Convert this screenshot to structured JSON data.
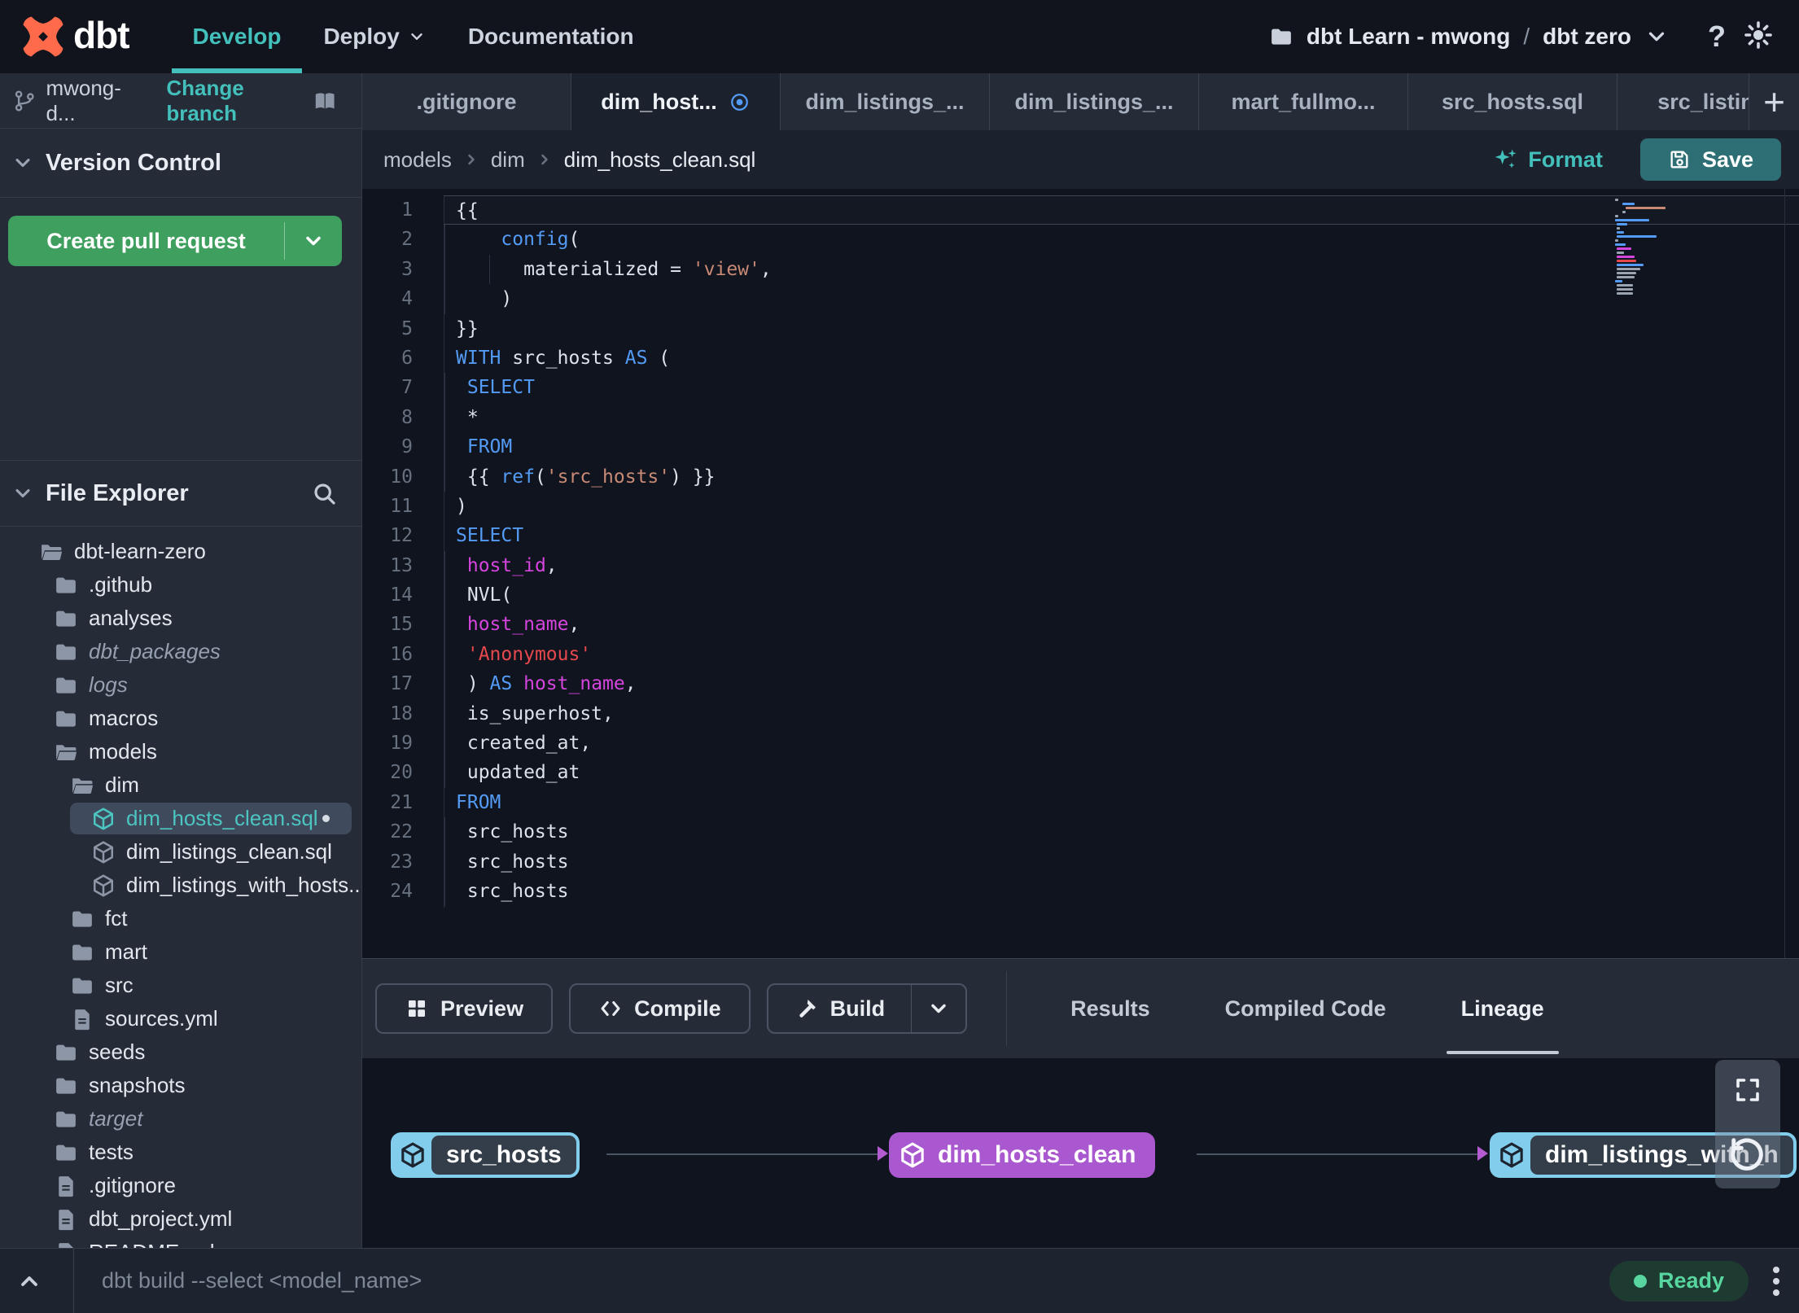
{
  "topnav": {
    "logo_text": "dbt",
    "items": [
      {
        "label": "Develop",
        "active": true,
        "caret": false
      },
      {
        "label": "Deploy",
        "active": false,
        "caret": true
      },
      {
        "label": "Documentation",
        "active": false,
        "caret": false
      }
    ],
    "account": "dbt Learn - mwong",
    "separator": "/",
    "project": "dbt zero"
  },
  "sidebar": {
    "branch_name": "mwong-d...",
    "change_branch_label": "Change branch",
    "version_control_label": "Version Control",
    "create_pr_label": "Create pull request",
    "file_explorer_label": "File Explorer",
    "tree": [
      {
        "label": "dbt-learn-zero",
        "icon": "folder-open",
        "level": 0
      },
      {
        "label": ".github",
        "icon": "folder",
        "level": 1
      },
      {
        "label": "analyses",
        "icon": "folder",
        "level": 1
      },
      {
        "label": "dbt_packages",
        "icon": "folder",
        "level": 1,
        "italic": true
      },
      {
        "label": "logs",
        "icon": "folder",
        "level": 1,
        "italic": true
      },
      {
        "label": "macros",
        "icon": "folder",
        "level": 1
      },
      {
        "label": "models",
        "icon": "folder-open",
        "level": 1
      },
      {
        "label": "dim",
        "icon": "folder-open",
        "level": 2
      },
      {
        "label": "dim_hosts_clean.sql",
        "icon": "model",
        "level": 3,
        "selected": true,
        "modified": true
      },
      {
        "label": "dim_listings_clean.sql",
        "icon": "model",
        "level": 3
      },
      {
        "label": "dim_listings_with_hosts...",
        "icon": "model",
        "level": 3
      },
      {
        "label": "fct",
        "icon": "folder",
        "level": 2
      },
      {
        "label": "mart",
        "icon": "folder",
        "level": 2
      },
      {
        "label": "src",
        "icon": "folder",
        "level": 2
      },
      {
        "label": "sources.yml",
        "icon": "file",
        "level": 2
      },
      {
        "label": "seeds",
        "icon": "folder",
        "level": 1
      },
      {
        "label": "snapshots",
        "icon": "folder",
        "level": 1
      },
      {
        "label": "target",
        "icon": "folder",
        "level": 1,
        "italic": true
      },
      {
        "label": "tests",
        "icon": "folder",
        "level": 1
      },
      {
        "label": ".gitignore",
        "icon": "file",
        "level": 1
      },
      {
        "label": "dbt_project.yml",
        "icon": "file",
        "level": 1
      },
      {
        "label": "README.md",
        "icon": "file",
        "level": 1
      }
    ]
  },
  "tabs": {
    "items": [
      {
        "label": ".gitignore"
      },
      {
        "label": "dim_host...",
        "active": true,
        "modified": true
      },
      {
        "label": "dim_listings_..."
      },
      {
        "label": "dim_listings_..."
      },
      {
        "label": "mart_fullmo..."
      },
      {
        "label": "src_hosts.sql"
      },
      {
        "label": "src_listings."
      }
    ],
    "add_label": "+"
  },
  "editor_header": {
    "breadcrumb": [
      "models",
      "dim",
      "dim_hosts_clean.sql"
    ],
    "format_label": "Format",
    "save_label": "Save"
  },
  "editor": {
    "lines": [
      {
        "n": 1,
        "current": true,
        "tokens": [
          [
            "w",
            "{{"
          ]
        ]
      },
      {
        "n": 2,
        "guides": [
          0
        ],
        "tokens": [
          [
            "w",
            "    "
          ],
          [
            "b",
            "config"
          ],
          [
            "w",
            "("
          ]
        ]
      },
      {
        "n": 3,
        "guides": [
          0,
          4
        ],
        "tokens": [
          [
            "w",
            "      materialized = "
          ],
          [
            "s",
            "'view'"
          ],
          [
            "w",
            ","
          ]
        ]
      },
      {
        "n": 4,
        "guides": [
          0
        ],
        "tokens": [
          [
            "w",
            "    )"
          ]
        ]
      },
      {
        "n": 5,
        "tokens": [
          [
            "w",
            "}}"
          ]
        ]
      },
      {
        "n": 6,
        "tokens": [
          [
            "b",
            "WITH"
          ],
          [
            "w",
            " src_hosts "
          ],
          [
            "b",
            "AS"
          ],
          [
            "w",
            " ("
          ]
        ]
      },
      {
        "n": 7,
        "guides": [
          0
        ],
        "tokens": [
          [
            "w",
            " "
          ],
          [
            "b",
            "SELECT"
          ]
        ]
      },
      {
        "n": 8,
        "guides": [
          0
        ],
        "tokens": [
          [
            "w",
            " *"
          ]
        ]
      },
      {
        "n": 9,
        "guides": [
          0
        ],
        "tokens": [
          [
            "w",
            " "
          ],
          [
            "b",
            "FROM"
          ]
        ]
      },
      {
        "n": 10,
        "guides": [
          0
        ],
        "tokens": [
          [
            "w",
            " {{ "
          ],
          [
            "b",
            "ref"
          ],
          [
            "w",
            "("
          ],
          [
            "s",
            "'src_hosts'"
          ],
          [
            "w",
            ") }}"
          ]
        ]
      },
      {
        "n": 11,
        "tokens": [
          [
            "w",
            ")"
          ]
        ]
      },
      {
        "n": 12,
        "tokens": [
          [
            "b",
            "SELECT"
          ]
        ]
      },
      {
        "n": 13,
        "guides": [
          0
        ],
        "tokens": [
          [
            "w",
            " "
          ],
          [
            "m",
            "host_id"
          ],
          [
            "w",
            ","
          ]
        ]
      },
      {
        "n": 14,
        "guides": [
          0
        ],
        "tokens": [
          [
            "w",
            " NVL("
          ]
        ]
      },
      {
        "n": 15,
        "guides": [
          0
        ],
        "tokens": [
          [
            "w",
            " "
          ],
          [
            "m",
            "host_name"
          ],
          [
            "w",
            ","
          ]
        ]
      },
      {
        "n": 16,
        "guides": [
          0
        ],
        "tokens": [
          [
            "w",
            " "
          ],
          [
            "r",
            "'Anonymous'"
          ]
        ]
      },
      {
        "n": 17,
        "guides": [
          0
        ],
        "tokens": [
          [
            "w",
            " ) "
          ],
          [
            "b",
            "AS"
          ],
          [
            "w",
            " "
          ],
          [
            "m",
            "host_name"
          ],
          [
            "w",
            ","
          ]
        ]
      },
      {
        "n": 18,
        "guides": [
          0
        ],
        "tokens": [
          [
            "w",
            " is_superhost,"
          ]
        ]
      },
      {
        "n": 19,
        "guides": [
          0
        ],
        "tokens": [
          [
            "w",
            " created_at,"
          ]
        ]
      },
      {
        "n": 20,
        "guides": [
          0
        ],
        "tokens": [
          [
            "w",
            " updated_at"
          ]
        ]
      },
      {
        "n": 21,
        "tokens": [
          [
            "b",
            "FROM"
          ]
        ]
      },
      {
        "n": 22,
        "guides": [
          0
        ],
        "tokens": [
          [
            "w",
            " src_hosts"
          ]
        ]
      },
      {
        "n": 23,
        "guides": [
          0
        ],
        "tokens": [
          [
            "w",
            " src_hosts"
          ]
        ]
      },
      {
        "n": 24,
        "guides": [
          0
        ],
        "tokens": [
          [
            "w",
            " src_hosts"
          ]
        ]
      }
    ]
  },
  "bottom_toolbar": {
    "preview_label": "Preview",
    "compile_label": "Compile",
    "build_label": "Build",
    "tabs": [
      {
        "label": "Results"
      },
      {
        "label": "Compiled Code"
      },
      {
        "label": "Lineage",
        "active": true
      }
    ]
  },
  "lineage": {
    "nodes": [
      {
        "name": "src_hosts",
        "color": "blue"
      },
      {
        "name": "dim_hosts_clean",
        "color": "purple"
      },
      {
        "name": "dim_listings_with_h",
        "color": "blue"
      }
    ]
  },
  "statusbar": {
    "command": "dbt build --select <model_name>",
    "ready_label": "Ready"
  },
  "colors": {
    "accent_teal": "#43c0bb",
    "brand_orange": "#ff6a4b",
    "button_green": "#3f9f5f",
    "save_teal": "#2d6f74",
    "node_blue": "#82cdec",
    "node_purple": "#a958cf",
    "arrow_purple": "#b55bd2",
    "status_green": "#57d6a0",
    "code_keyword": "#539bf5",
    "code_identifier": "#d545dd",
    "code_string": "#c98a75",
    "code_string_red": "#e5484d"
  }
}
